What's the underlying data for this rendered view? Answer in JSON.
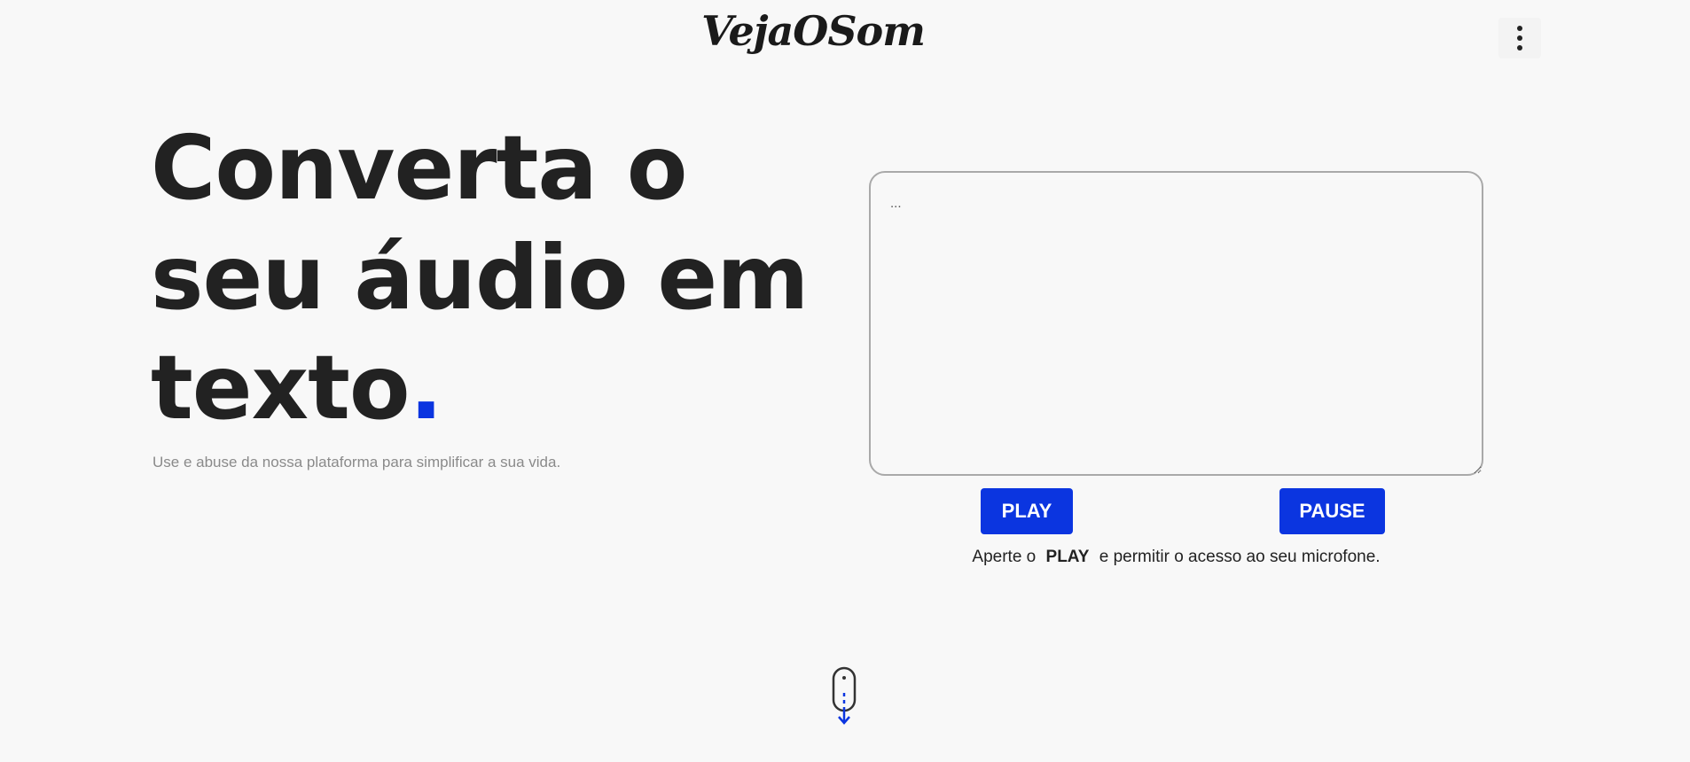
{
  "header": {
    "logo_text": "VejaOSom",
    "menu_icon": "kebab-vertical-icon"
  },
  "hero": {
    "title_text": "Converta o seu áudio em texto",
    "title_dot": ".",
    "subtitle": "Use e abuse da nossa plataforma para simplificar a sua vida."
  },
  "transcript": {
    "placeholder": "...",
    "value": ""
  },
  "controls": {
    "play_label": "PLAY",
    "pause_label": "PAUSE"
  },
  "instruction": {
    "before": "Aperte o",
    "emphasis": "PLAY",
    "after": "e permitir o acesso ao seu microfone."
  },
  "scroll": {
    "icon": "mouse-scroll-down-icon"
  },
  "colors": {
    "accent": "#0b35e0",
    "background": "#f8f8f8",
    "text": "#222222",
    "muted": "#8a8a8a"
  }
}
